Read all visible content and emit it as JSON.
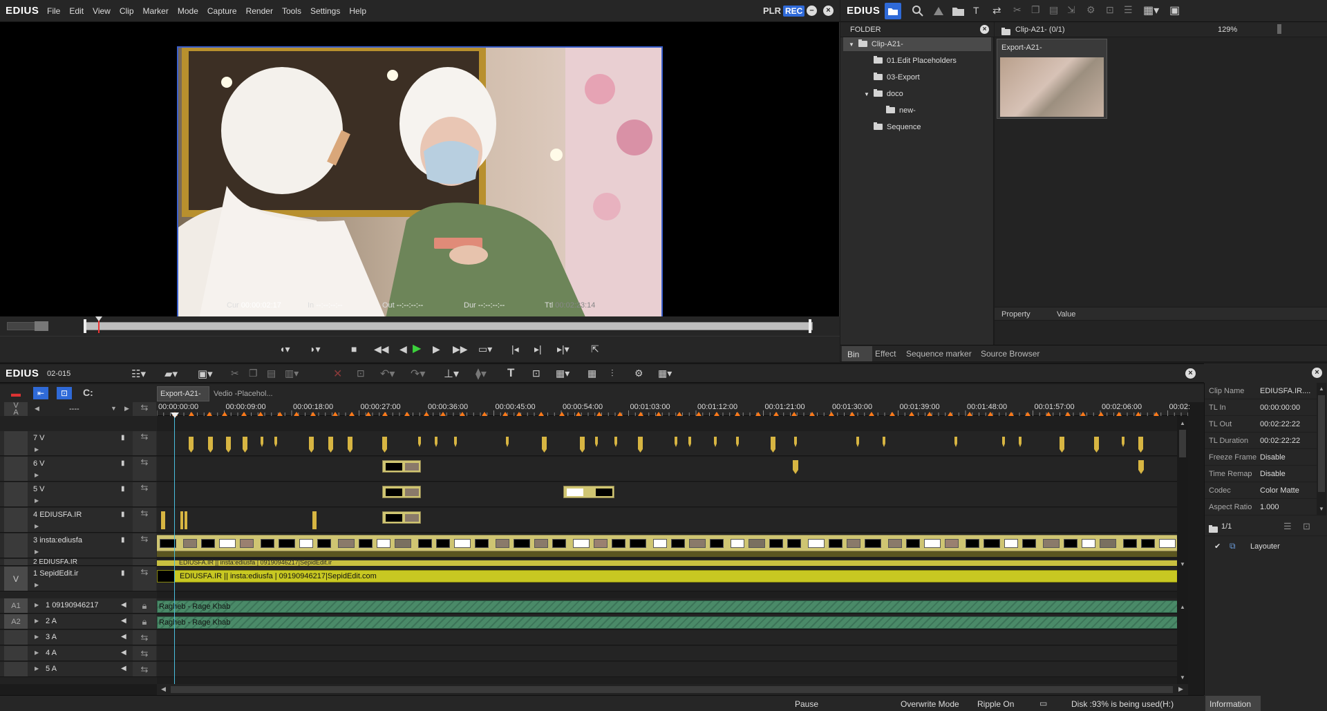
{
  "app": {
    "name": "EDIUS"
  },
  "menu": [
    "File",
    "Edit",
    "View",
    "Clip",
    "Marker",
    "Mode",
    "Capture",
    "Render",
    "Tools",
    "Settings",
    "Help"
  ],
  "player": {
    "mode_plr": "PLR",
    "mode_rec": "REC",
    "timecodes": [
      {
        "label": "Cur",
        "value": "00:00:02:17"
      },
      {
        "label": "In",
        "value": "--:--:--:--"
      },
      {
        "label": "Out",
        "value": "--:--:--:--"
      },
      {
        "label": "Dur",
        "value": "--:--:--:--"
      },
      {
        "label": "Ttl",
        "value": "00:02:23:14"
      }
    ]
  },
  "bin": {
    "title": "EDIUS",
    "folder_header": "FOLDER",
    "path": "Clip-A21- (0/1)",
    "zoom": "129%",
    "tree": [
      {
        "label": "Clip-A21-",
        "selected": true
      },
      {
        "label": "01.Edit Placeholders"
      },
      {
        "label": "03-Export"
      },
      {
        "label": "doco"
      },
      {
        "label": "new-"
      },
      {
        "label": "Sequence"
      }
    ],
    "clip": {
      "name": "Export-A21-"
    },
    "property_headers": [
      "Property",
      "Value"
    ],
    "tabs": [
      "Bin",
      "Effect",
      "Sequence marker",
      "Source Browser"
    ]
  },
  "timeline": {
    "title": "EDIUS",
    "sequence_id": "02-015",
    "seq_tabs": [
      "Export-A21-",
      "Vedio -Placehol..."
    ],
    "track_dropdown": "----",
    "ruler": [
      "00:00:00:00",
      "00:00:09:00",
      "00:00:18:00",
      "00:00:27:00",
      "00:00:36:00",
      "00:00:45:00",
      "00:00:54:00",
      "00:01:03:00",
      "00:01:12:00",
      "00:01:21:00",
      "00:01:30:00",
      "00:01:39:00",
      "00:01:48:00",
      "00:01:57:00",
      "00:02:06:00",
      "00:02:"
    ],
    "tracks_v": [
      {
        "id": "7 V",
        "name": ""
      },
      {
        "id": "6 V",
        "name": ""
      },
      {
        "id": "5 V",
        "name": ""
      },
      {
        "id": "4",
        "name": "EDIUSFA.IR"
      },
      {
        "id": "3",
        "name": "insta:ediusfa"
      },
      {
        "id": "2",
        "name": "EDIUSFA.IR"
      },
      {
        "id": "1",
        "name": "SepidEdit.ir"
      }
    ],
    "tracks_a": [
      {
        "tag": "A1",
        "id": "1",
        "name": "09190946217"
      },
      {
        "tag": "A2",
        "id": "2",
        "name": "A"
      },
      {
        "tag": "",
        "id": "3",
        "name": "A"
      },
      {
        "tag": "",
        "id": "4",
        "name": "A"
      },
      {
        "tag": "",
        "id": "5",
        "name": "A"
      }
    ],
    "v_tag": "V",
    "a_tag": "A",
    "v1_tag": "V",
    "title_clip_text": "EDIUSFA.IR || insta:ediusfa |  09190946217|SepidEdit.com",
    "title_clip_text_top": "EDIUSFA.IR || insta:ediusfa |  09190946217|SepidEdit.ir",
    "audio_clip": "Ragheb - Rage Khab"
  },
  "info": {
    "rows": [
      {
        "k": "Clip Name",
        "v": "EDIUSFA.IR...."
      },
      {
        "k": "TL In",
        "v": "00:00:00:00"
      },
      {
        "k": "TL Out",
        "v": "00:02:22:22"
      },
      {
        "k": "TL Duration",
        "v": "00:02:22:22"
      },
      {
        "k": "Freeze Frame",
        "v": "Disable"
      },
      {
        "k": "Time Remap",
        "v": "Disable"
      },
      {
        "k": "Codec",
        "v": "Color Matte"
      },
      {
        "k": "Aspect Ratio",
        "v": "1.000"
      }
    ],
    "page": "1/1",
    "effect": "Layouter",
    "tab": "Information"
  },
  "status": {
    "state": "Pause",
    "mode": "Overwrite Mode",
    "ripple": "Ripple On",
    "disk": "Disk :93% is being used(H:)"
  },
  "colors": {
    "accent": "#2f6ad8",
    "title_clip": "#c8c822",
    "audio_clip": "#4a8a68",
    "video_clip": "#cfc572",
    "marker": "#ff7a1a"
  }
}
